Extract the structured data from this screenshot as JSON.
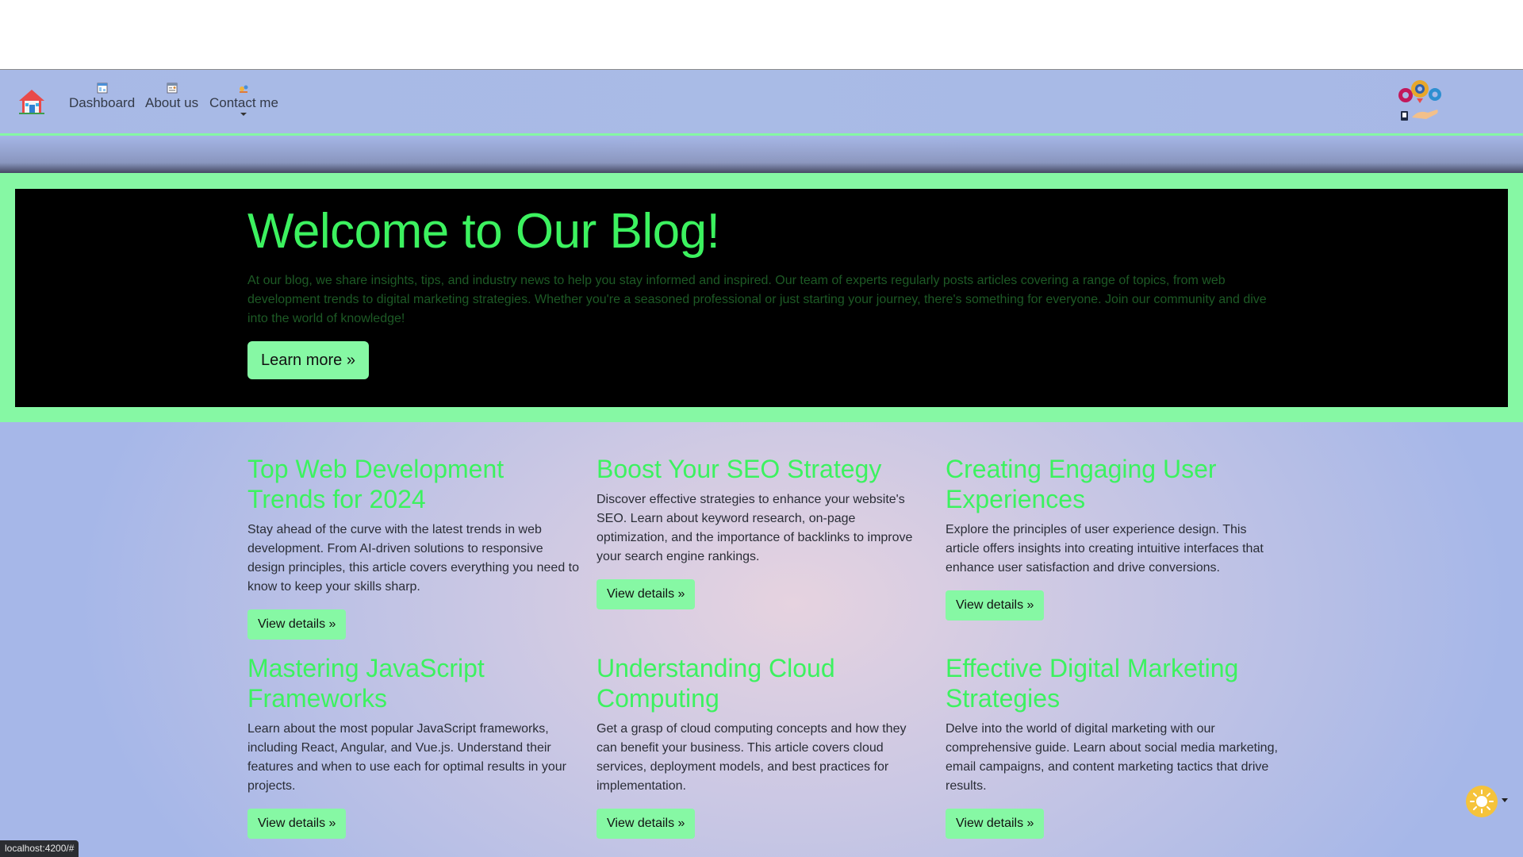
{
  "nav": {
    "items": [
      {
        "label": "Dashboard"
      },
      {
        "label": "About us"
      },
      {
        "label": "Contact me"
      }
    ]
  },
  "hero": {
    "title": "Welcome to Our Blog!",
    "text": "At our blog, we share insights, tips, and industry news to help you stay informed and inspired. Our team of experts regularly posts articles covering a range of topics, from web development trends to digital marketing strategies. Whether you're a seasoned professional or just starting your journey, there's something for everyone. Join our community and dive into the world of knowledge!",
    "button": "Learn more »"
  },
  "cards": [
    {
      "title": "Top Web Development Trends for 2024",
      "text": "Stay ahead of the curve with the latest trends in web development. From AI-driven solutions to responsive design principles, this article covers everything you need to know to keep your skills sharp.",
      "button": "View details »"
    },
    {
      "title": "Boost Your SEO Strategy",
      "text": "Discover effective strategies to enhance your website's SEO. Learn about keyword research, on-page optimization, and the importance of backlinks to improve your search engine rankings.",
      "button": "View details »"
    },
    {
      "title": "Creating Engaging User Experiences",
      "text": "Explore the principles of user experience design. This article offers insights into creating intuitive interfaces that enhance user satisfaction and drive conversions.",
      "button": "View details »"
    },
    {
      "title": "Mastering JavaScript Frameworks",
      "text": "Learn about the most popular JavaScript frameworks, including React, Angular, and Vue.js. Understand their features and when to use each for optimal results in your projects.",
      "button": "View details »"
    },
    {
      "title": "Understanding Cloud Computing",
      "text": "Get a grasp of cloud computing concepts and how they can benefit your business. This article covers cloud services, deployment models, and best practices for implementation.",
      "button": "View details »"
    },
    {
      "title": "Effective Digital Marketing Strategies",
      "text": "Delve into the world of digital marketing with our comprehensive guide. Learn about social media marketing, email campaigns, and content marketing tactics that drive results.",
      "button": "View details »"
    }
  ],
  "status_bar": {
    "url": "localhost:4200/#"
  },
  "colors": {
    "accent_green": "#86f8a4",
    "title_green": "#3cf25f",
    "hero_bg": "#000000",
    "toggle_yellow": "#f5c33b"
  }
}
